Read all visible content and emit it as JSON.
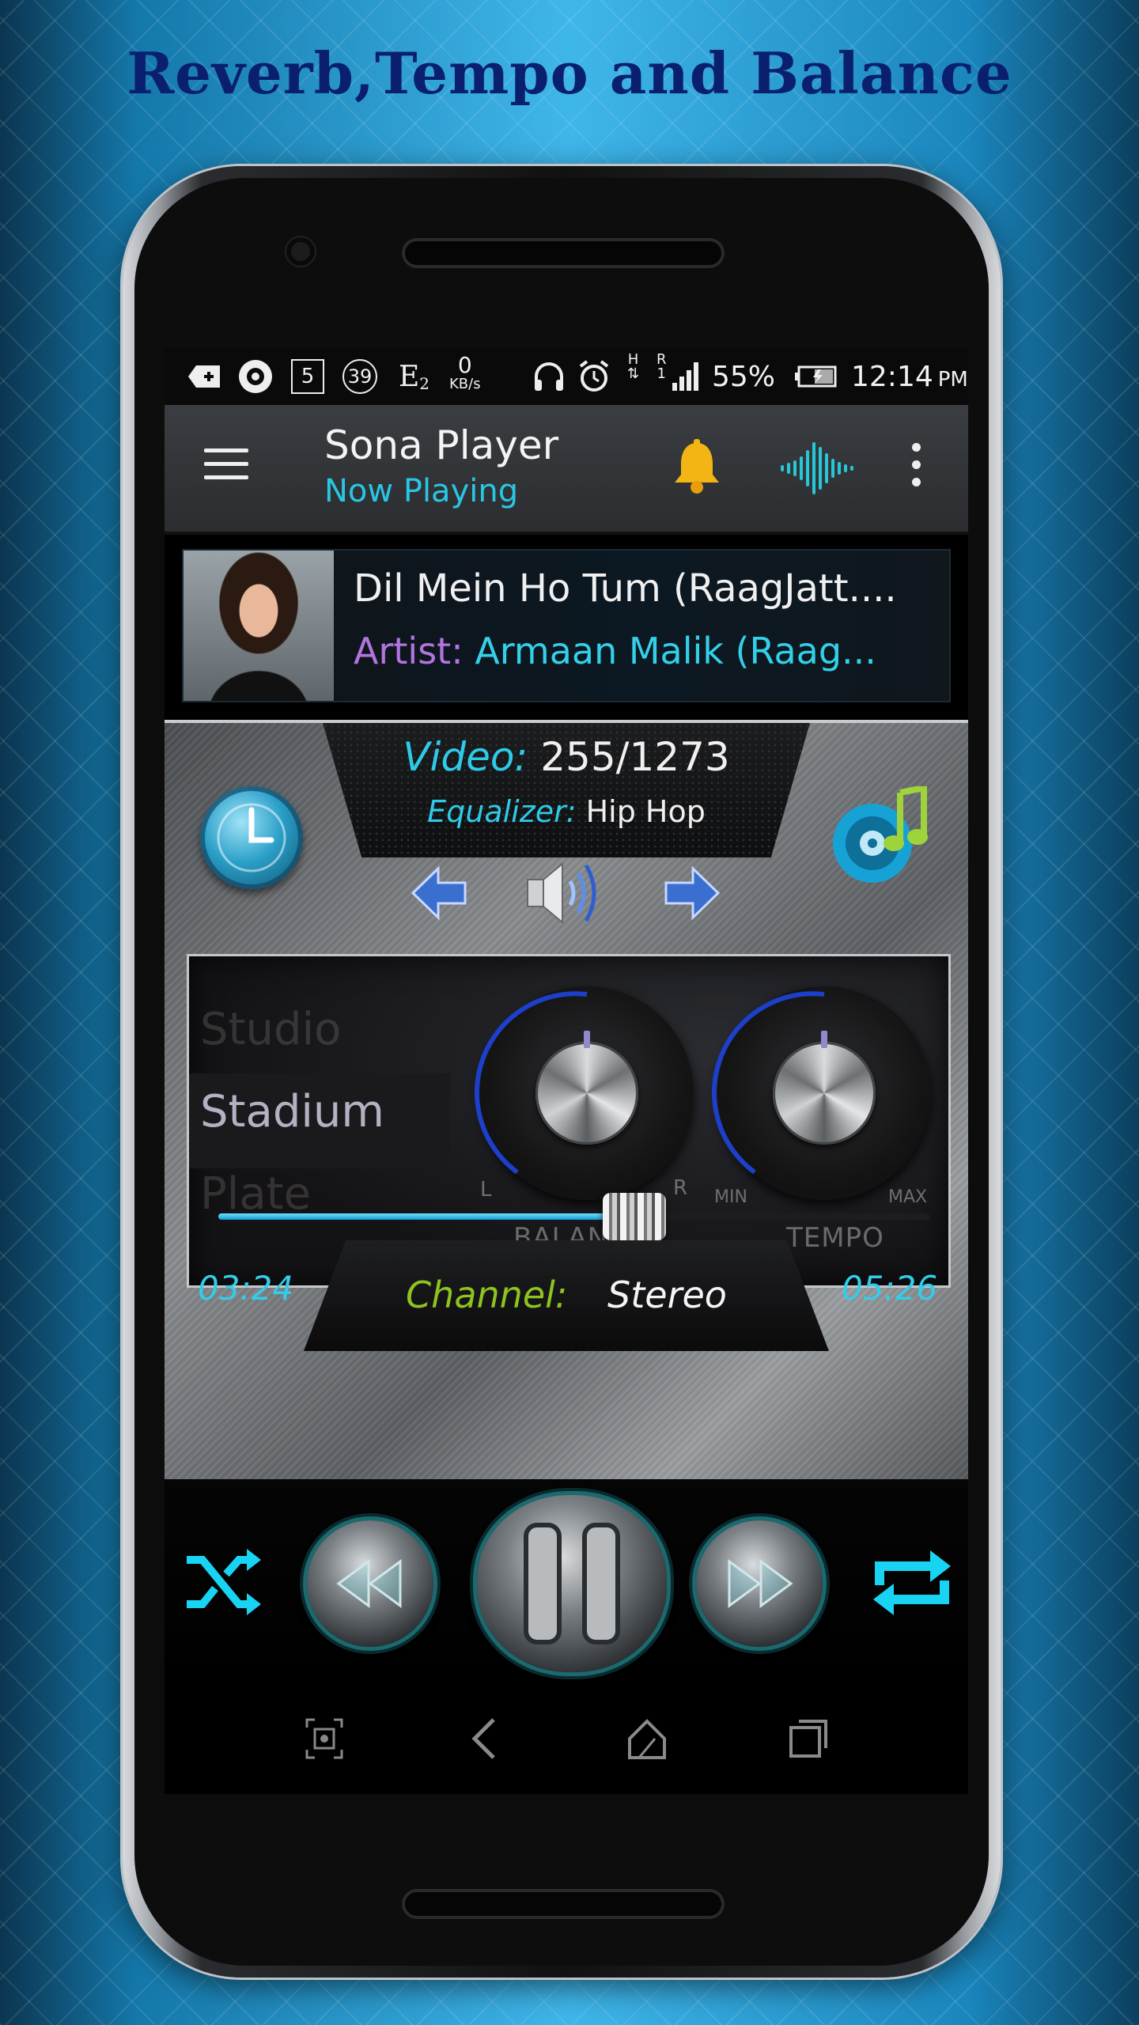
{
  "promo": {
    "title": "Reverb,Tempo and Balance"
  },
  "status_bar": {
    "box_number": "5",
    "circle_number": "39",
    "network_e": "E",
    "network_e_sub": "2",
    "speed_value": "0",
    "speed_unit": "KB/s",
    "signal_h": "H",
    "signal_r": "R",
    "signal_r_sub": "1",
    "battery": "55%",
    "time": "12:14",
    "ampm": "PM"
  },
  "toolbar": {
    "title": "Sona Player",
    "subtitle": "Now Playing"
  },
  "song": {
    "title": "Dil Mein Ho Tum (RaagJatt....",
    "artist_label": "Artist:",
    "artist_name": "Armaan Malik (Raag..."
  },
  "info": {
    "video_label": "Video:",
    "video_count": "255/1273",
    "equalizer_label": "Equalizer:",
    "equalizer_value": "Hip Hop"
  },
  "reverb": {
    "presets": [
      "Studio",
      "Stadium",
      "Plate"
    ],
    "selected": "Stadium"
  },
  "balance": {
    "name": "BALANCE",
    "min_label": "L",
    "max_label": "R",
    "level": 0.5
  },
  "tempo": {
    "name": "TEMPO",
    "min_label": "MIN",
    "max_label": "MAX",
    "level": 0.5
  },
  "playback": {
    "current_time": "03:24",
    "total_time": "05:26",
    "progress": 0.647,
    "channel_label": "Channel:",
    "channel_value": "Stereo"
  },
  "colors": {
    "accent": "#29c6e4",
    "artist_label": "#b274e0",
    "channel_label": "#8fc31f",
    "knob_arc": "#1d3fc9",
    "promo_title": "#0a1f6e"
  },
  "icons": {
    "menu": "menu-icon",
    "bell": "bell-icon",
    "visualizer": "waveform-icon",
    "more": "more-vert-icon",
    "clock": "clock-icon",
    "music": "music-note-icon",
    "shuffle": "shuffle-icon",
    "repeat": "repeat-icon"
  }
}
